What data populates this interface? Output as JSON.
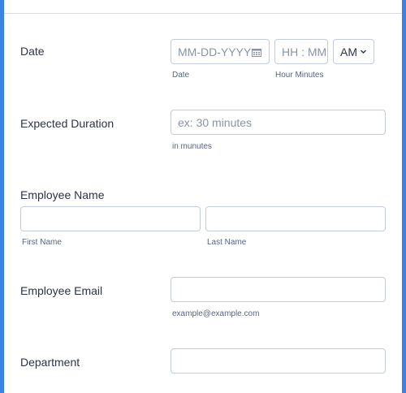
{
  "form": {
    "date": {
      "label": "Date",
      "date_placeholder": "MM-DD-YYYY",
      "date_sub": "Date",
      "time_placeholder": "HH : MM",
      "time_sub": "Hour Minutes",
      "ampm_value": "AM"
    },
    "duration": {
      "label": "Expected Duration",
      "placeholder": "ex: 30 minutes",
      "sub": "in munutes"
    },
    "employee_name": {
      "label": "Employee Name",
      "first_sub": "First Name",
      "last_sub": "Last Name"
    },
    "employee_email": {
      "label": "Employee Email",
      "sub": "example@example.com"
    },
    "department": {
      "label": "Department"
    }
  },
  "colors": {
    "page_bg": "#3b82e6",
    "card_bg": "#ffffff",
    "text": "#2c3345",
    "muted": "#57647e",
    "border": "#c3cad8"
  }
}
